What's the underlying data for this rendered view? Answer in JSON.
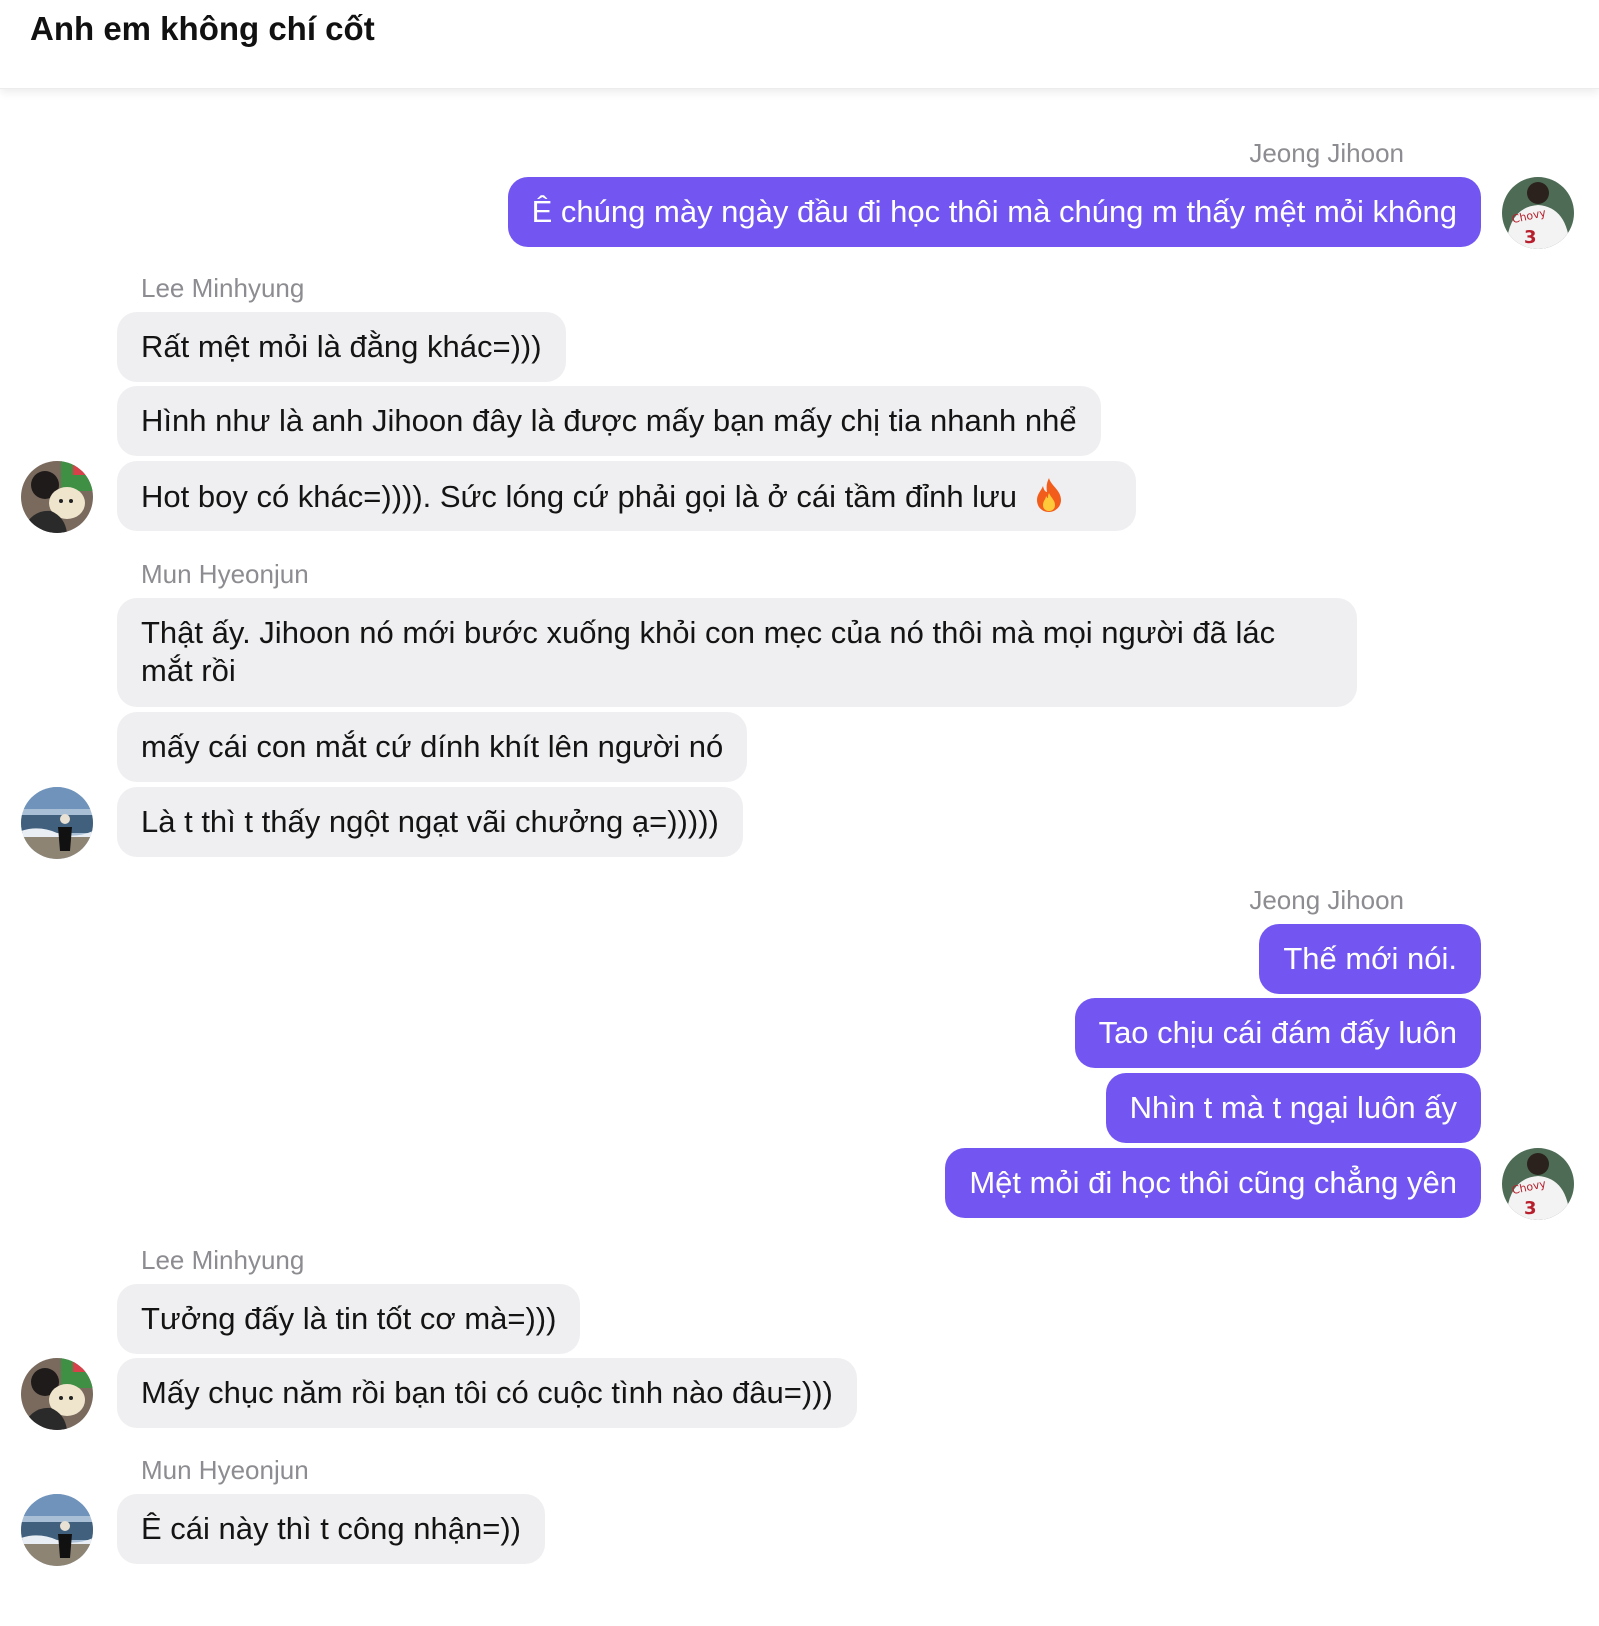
{
  "header": {
    "title": "Anh em không chí cốt"
  },
  "groups": [
    {
      "sender": "Jeong Jihoon",
      "side": "right",
      "messages": [
        "Ê chúng mày ngày đầu đi học thôi mà chúng m thấy mệt mỏi không"
      ]
    },
    {
      "sender": "Lee Minhyung",
      "side": "left",
      "messages": [
        "Rất mệt mỏi là đằng khác=)))",
        "Hình như là anh Jihoon đây là được mấy bạn mấy chị tia nhanh nhể",
        "Hot boy có khác=)))). Sức lóng cứ phải gọi là ở cái tầm đỉnh lưu"
      ]
    },
    {
      "sender": "Mun Hyeonjun",
      "side": "left",
      "messages": [
        "Thật ấy. Jihoon nó mới bước xuống khỏi con mẹc của nó thôi mà mọi người đã lác mắt rồi",
        "mấy cái con mắt cứ dính khít lên người nó",
        "Là t thì t thấy ngột ngạt vãi chưởng ạ=)))))"
      ]
    },
    {
      "sender": "Jeong Jihoon",
      "side": "right",
      "messages": [
        "Thế mới nói.",
        "Tao chịu cái đám đấy luôn",
        "Nhìn t mà t ngại luôn ấy",
        "Mệt mỏi đi học thôi cũng chẳng yên"
      ]
    },
    {
      "sender": "Lee Minhyung",
      "side": "left",
      "messages": [
        "Tưởng đấy là tin tốt cơ mà=)))",
        "Mấy chục năm rồi bạn tôi có cuộc tình nào đâu=)))"
      ]
    },
    {
      "sender": "Mun Hyeonjun",
      "side": "left",
      "messages": [
        "Ê cái này thì t công nhận=))"
      ]
    }
  ],
  "icons": {
    "fire": "fire-emoji",
    "jihoon_jersey_text": "Chovy",
    "jihoon_jersey_number": "3"
  },
  "colors": {
    "outgoing_bubble": "#7356f1",
    "incoming_bubble": "#efeff1",
    "sender_name": "#8c8c91"
  }
}
